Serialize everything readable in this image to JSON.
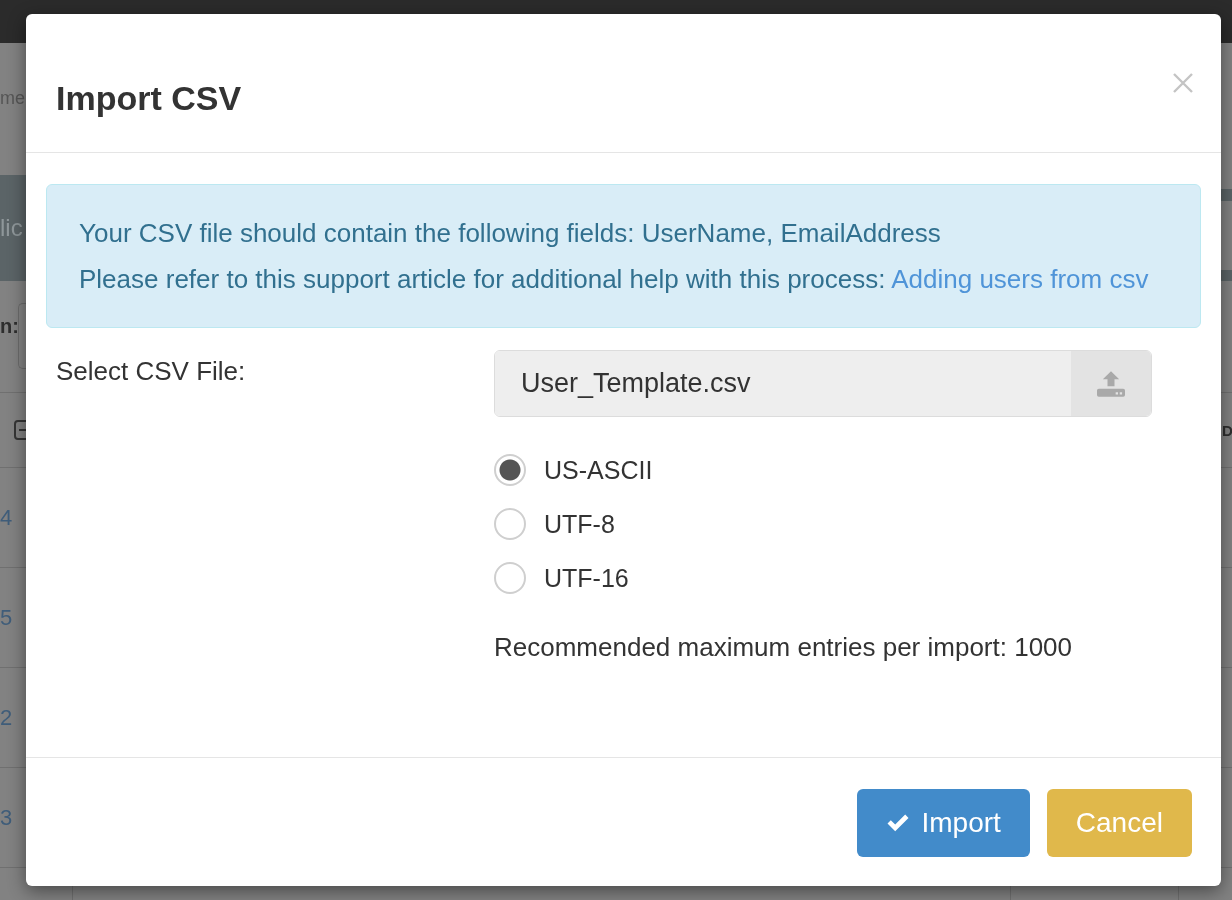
{
  "backdrop": {
    "header_fragment": "me",
    "banner_fragment": "lic",
    "filter_label_fragment": "n:",
    "column_header_fragment": "D",
    "row_numbers": [
      "4",
      "5",
      "2",
      "3"
    ]
  },
  "dialog": {
    "title": "Import CSV",
    "alert": {
      "lines": [
        {
          "text": "Your CSV file should contain the following fields: UserName, EmailAddress"
        },
        {
          "text": "Please refer to this support article for additional help with this process:",
          "link": "Adding users from csv"
        }
      ]
    },
    "file_field": {
      "label": "Select CSV File:",
      "value": "User_Template.csv"
    },
    "encodings": [
      {
        "label": "US-ASCII",
        "selected": true
      },
      {
        "label": "UTF-8",
        "selected": false
      },
      {
        "label": "UTF-16",
        "selected": false
      }
    ],
    "note": "Recommended maximum entries per import: 1000",
    "buttons": [
      {
        "label": "Import",
        "kind": "primary"
      },
      {
        "label": "Cancel",
        "kind": "warning"
      }
    ]
  }
}
